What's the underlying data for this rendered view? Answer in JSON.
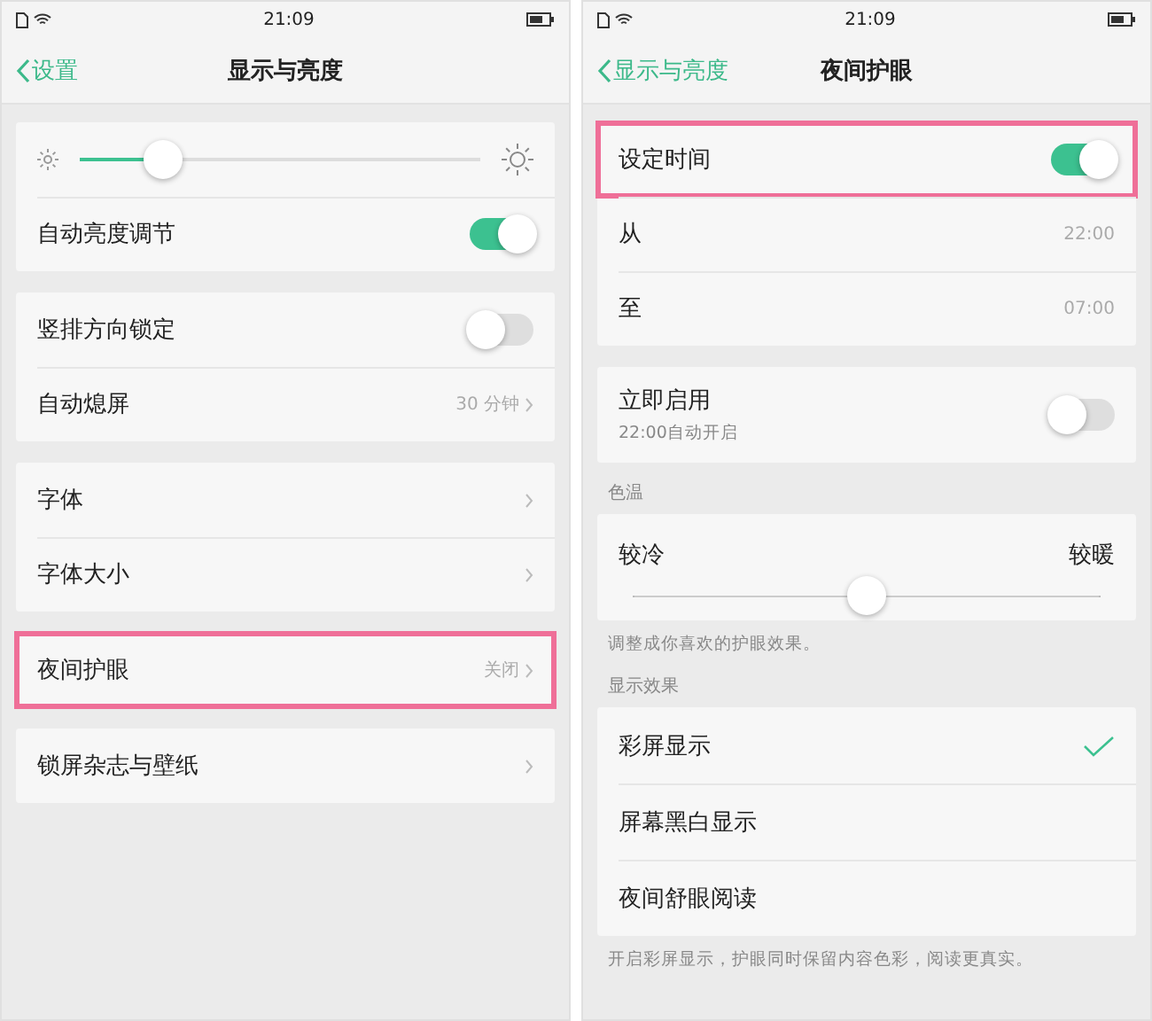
{
  "screens": [
    {
      "status_bar": {
        "time": "21:09"
      },
      "nav": {
        "back": "设置",
        "title": "显示与亮度"
      },
      "groups": [
        {
          "rows": [
            {
              "kind": "slider",
              "level": 0.21,
              "highlighted": false
            },
            {
              "kind": "toggle",
              "label": "自动亮度调节",
              "on": true,
              "highlighted": false
            }
          ]
        },
        {
          "rows": [
            {
              "kind": "toggle",
              "label": "竖排方向锁定",
              "on": false,
              "highlighted": false
            },
            {
              "kind": "link",
              "label": "自动熄屏",
              "value": "30 分钟",
              "highlighted": false
            }
          ]
        },
        {
          "rows": [
            {
              "kind": "link",
              "label": "字体",
              "highlighted": false
            },
            {
              "kind": "link",
              "label": "字体大小",
              "highlighted": false
            }
          ]
        },
        {
          "rows": [
            {
              "kind": "link",
              "label": "夜间护眼",
              "value": "关闭",
              "highlighted": true
            }
          ]
        },
        {
          "rows": [
            {
              "kind": "link",
              "label": "锁屏杂志与壁纸",
              "highlighted": false
            }
          ]
        }
      ]
    },
    {
      "status_bar": {
        "time": "21:09"
      },
      "nav": {
        "back": "显示与亮度",
        "title": "夜间护眼"
      },
      "groups": [
        {
          "rows": [
            {
              "kind": "toggle",
              "label": "设定时间",
              "on": true,
              "highlighted": true
            },
            {
              "kind": "value",
              "label": "从",
              "value": "22:00",
              "highlighted": false
            },
            {
              "kind": "value",
              "label": "至",
              "value": "07:00",
              "highlighted": false
            }
          ]
        },
        {
          "rows": [
            {
              "kind": "toggle",
              "label": "立即启用",
              "subtitle": "22:00自动开启",
              "on": false,
              "highlighted": false
            }
          ]
        },
        {
          "label": "色温",
          "caption": "调整成你喜欢的护眼效果。",
          "rows": [
            {
              "kind": "range",
              "left": "较冷",
              "right": "较暖",
              "level": 0.5,
              "highlighted": false
            }
          ]
        },
        {
          "label": "显示效果",
          "caption": "开启彩屏显示，护眼同时保留内容色彩，阅读更真实。",
          "rows": [
            {
              "kind": "check",
              "label": "彩屏显示",
              "selected": true,
              "highlighted": false
            },
            {
              "kind": "check",
              "label": "屏幕黑白显示",
              "selected": false,
              "highlighted": false
            },
            {
              "kind": "check",
              "label": "夜间舒眼阅读",
              "selected": false,
              "highlighted": false
            }
          ]
        }
      ]
    }
  ]
}
